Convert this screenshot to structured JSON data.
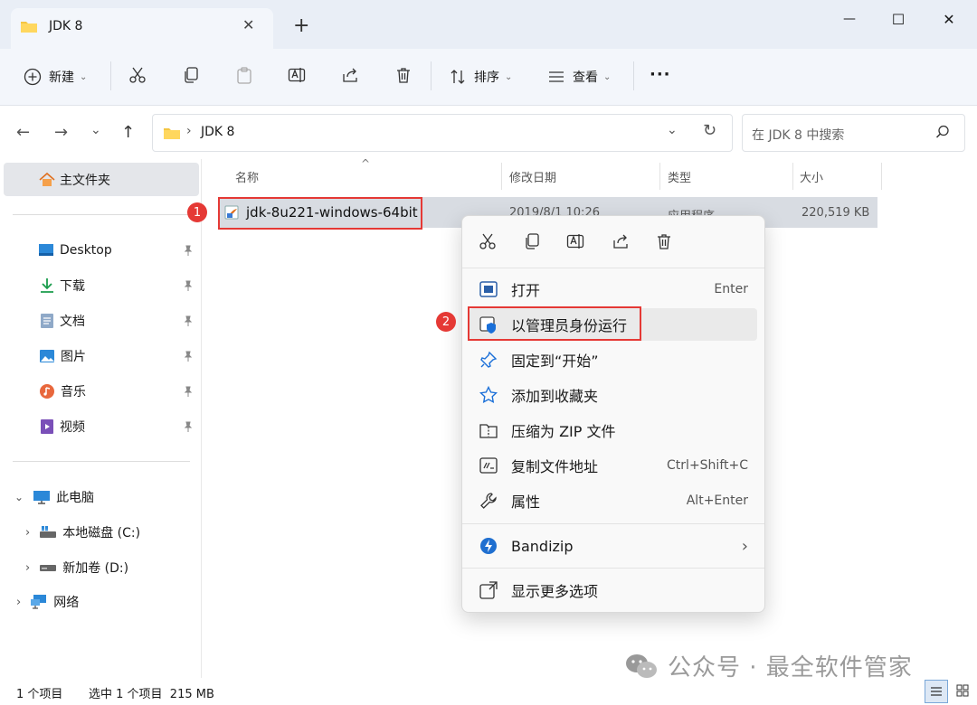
{
  "window": {
    "tab_title": "JDK 8",
    "new_tab": "+",
    "minimize": "—",
    "maximize": "☐",
    "close": "✕"
  },
  "toolbar": {
    "new_label": "新建",
    "sort_label": "排序",
    "view_label": "查看",
    "more_label": "···"
  },
  "address": {
    "path": "JDK 8",
    "search_placeholder": "在 JDK 8 中搜索"
  },
  "sidebar": {
    "home": "主文件夹",
    "quick": [
      {
        "label": "Desktop"
      },
      {
        "label": "下载"
      },
      {
        "label": "文档"
      },
      {
        "label": "图片"
      },
      {
        "label": "音乐"
      },
      {
        "label": "视频"
      }
    ],
    "this_pc": "此电脑",
    "drives": [
      {
        "label": "本地磁盘 (C:)"
      },
      {
        "label": "新加卷 (D:)"
      }
    ],
    "network": "网络"
  },
  "columns": {
    "name": "名称",
    "modified": "修改日期",
    "type": "类型",
    "size": "大小"
  },
  "file": {
    "name": "jdk-8u221-windows-64bit",
    "modified": "2019/8/1 10:26",
    "type": "应用程序",
    "size": "220,519 KB"
  },
  "context_menu": {
    "items": [
      {
        "label": "打开",
        "shortcut": "Enter"
      },
      {
        "label": "以管理员身份运行",
        "shortcut": ""
      },
      {
        "label": "固定到“开始”",
        "shortcut": ""
      },
      {
        "label": "添加到收藏夹",
        "shortcut": ""
      },
      {
        "label": "压缩为 ZIP 文件",
        "shortcut": ""
      },
      {
        "label": "复制文件地址",
        "shortcut": "Ctrl+Shift+C"
      },
      {
        "label": "属性",
        "shortcut": "Alt+Enter"
      }
    ],
    "bandizip": "Bandizip",
    "more_options": "显示更多选项"
  },
  "annotations": {
    "step1": "1",
    "step2": "2"
  },
  "status": {
    "count": "1 个项目",
    "selected": "选中 1 个项目  215 MB"
  },
  "watermark": "公众号 · 最全软件管家",
  "colors": {
    "accent": "#0067c0",
    "highlight_red": "#e53935",
    "folder": "#f4c542"
  }
}
